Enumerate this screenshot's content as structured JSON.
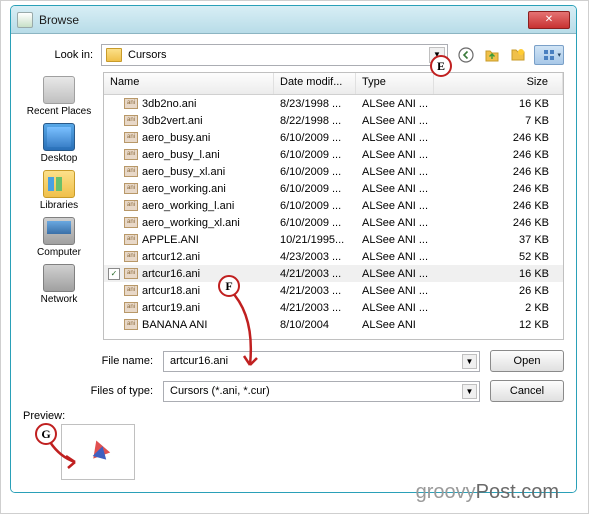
{
  "window": {
    "title": "Browse"
  },
  "lookIn": {
    "label": "Look in:",
    "value": "Cursors"
  },
  "toolbar": {
    "back": "back-icon",
    "up": "up-icon",
    "new": "new-folder-icon",
    "view": "view-menu-icon"
  },
  "places": [
    {
      "label": "Recent Places",
      "icon": "recent"
    },
    {
      "label": "Desktop",
      "icon": "desktop"
    },
    {
      "label": "Libraries",
      "icon": "lib"
    },
    {
      "label": "Computer",
      "icon": "comp"
    },
    {
      "label": "Network",
      "icon": "net"
    }
  ],
  "columns": {
    "name": "Name",
    "date": "Date modif...",
    "type": "Type",
    "size": "Size"
  },
  "files": [
    {
      "name": "3db2no.ani",
      "date": "8/23/1998 ...",
      "type": "ALSee ANI ...",
      "size": "16 KB"
    },
    {
      "name": "3db2vert.ani",
      "date": "8/22/1998 ...",
      "type": "ALSee ANI ...",
      "size": "7 KB"
    },
    {
      "name": "aero_busy.ani",
      "date": "6/10/2009 ...",
      "type": "ALSee ANI ...",
      "size": "246 KB"
    },
    {
      "name": "aero_busy_l.ani",
      "date": "6/10/2009 ...",
      "type": "ALSee ANI ...",
      "size": "246 KB"
    },
    {
      "name": "aero_busy_xl.ani",
      "date": "6/10/2009 ...",
      "type": "ALSee ANI ...",
      "size": "246 KB"
    },
    {
      "name": "aero_working.ani",
      "date": "6/10/2009 ...",
      "type": "ALSee ANI ...",
      "size": "246 KB"
    },
    {
      "name": "aero_working_l.ani",
      "date": "6/10/2009 ...",
      "type": "ALSee ANI ...",
      "size": "246 KB"
    },
    {
      "name": "aero_working_xl.ani",
      "date": "6/10/2009 ...",
      "type": "ALSee ANI ...",
      "size": "246 KB"
    },
    {
      "name": "APPLE.ANI",
      "date": "10/21/1995...",
      "type": "ALSee ANI ...",
      "size": "37 KB"
    },
    {
      "name": "artcur12.ani",
      "date": "4/23/2003 ...",
      "type": "ALSee ANI ...",
      "size": "52 KB"
    },
    {
      "name": "artcur16.ani",
      "date": "4/21/2003 ...",
      "type": "ALSee ANI ...",
      "size": "16 KB",
      "selected": true,
      "checked": true
    },
    {
      "name": "artcur18.ani",
      "date": "4/21/2003 ...",
      "type": "ALSee ANI ...",
      "size": "26 KB"
    },
    {
      "name": "artcur19.ani",
      "date": "4/21/2003 ...",
      "type": "ALSee ANI ...",
      "size": "2 KB"
    },
    {
      "name": "BANANA ANI",
      "date": "8/10/2004",
      "type": "ALSee ANI",
      "size": "12 KB"
    }
  ],
  "fileName": {
    "label": "File name:",
    "value": "artcur16.ani"
  },
  "fileType": {
    "label": "Files of type:",
    "value": "Cursors (*.ani, *.cur)"
  },
  "buttons": {
    "open": "Open",
    "cancel": "Cancel"
  },
  "preview": {
    "label": "Preview:"
  },
  "callouts": {
    "E": "E",
    "F": "F",
    "G": "G"
  },
  "watermark": {
    "brand": "groovy",
    "suffix": "Post.com"
  }
}
